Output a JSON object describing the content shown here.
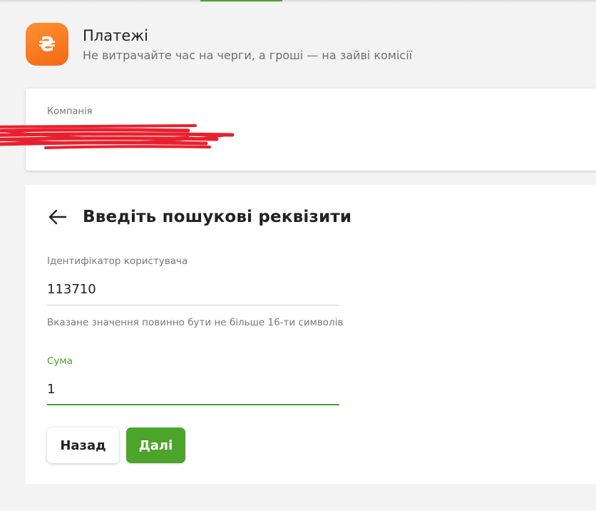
{
  "header": {
    "logo_symbol": "₴",
    "title": "Платежі",
    "subtitle": "Не витрачайте час на черги, а гроші — на зайві комісії"
  },
  "company": {
    "label": "Компанія"
  },
  "form": {
    "title": "Введіть пошукові реквізити",
    "user_id": {
      "label": "Ідентифікатор користувача",
      "value": "113710",
      "hint": "Вказане значення повинно бути не більше 16-ти символів"
    },
    "amount": {
      "label": "Сума",
      "value": "1"
    },
    "back_label": "Назад",
    "next_label": "Далі"
  },
  "icons": {
    "logo": "hryvnia-icon",
    "back": "arrow-left-icon"
  },
  "colors": {
    "accent_green": "#4da42b",
    "logo_orange": "#f47a1f",
    "redaction_red": "#e8202e"
  }
}
